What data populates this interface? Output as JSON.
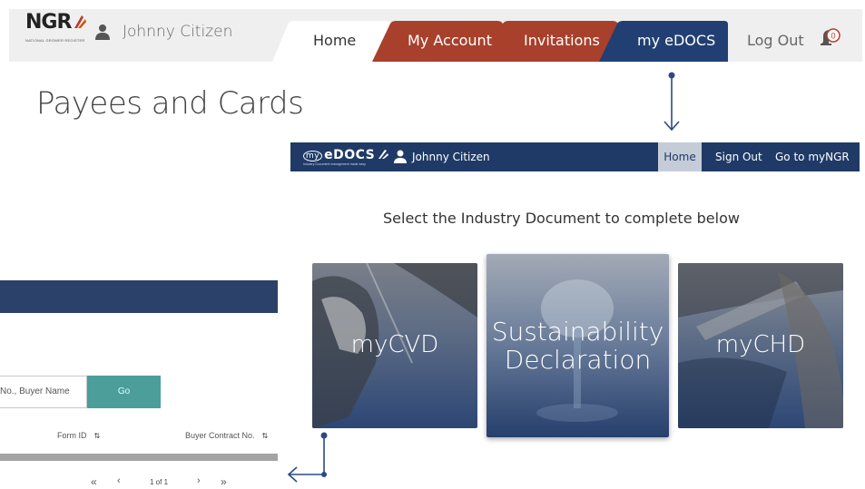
{
  "ngr_header": {
    "logo_text": "NGR",
    "logo_subtext": "NATIONAL GROWER REGISTER",
    "user_name": "Johnny Citizen",
    "tabs": [
      {
        "label": "Home"
      },
      {
        "label": "My Account"
      },
      {
        "label": "Invitations"
      },
      {
        "label": "my eDOCS"
      }
    ],
    "logout_label": "Log Out",
    "notification_count": "0",
    "colors": {
      "tab_rust": "#a8402b",
      "tab_navy": "#213f72",
      "bar_bg": "#efefef"
    }
  },
  "page_title": "Payees and Cards",
  "edocs_header": {
    "logo_my": "my",
    "logo_text": "eDOCS",
    "logo_subtext": "Industry Document management made easy",
    "user_name": "Johnny Citizen",
    "nav": {
      "home": "Home",
      "sign_out": "Sign Out",
      "go_to": "Go to myNGR"
    },
    "colors": {
      "bar_bg": "#1f3a66",
      "active_bg": "#c4ccd8"
    }
  },
  "select_prompt": "Select the Industry Document to complete below",
  "cards": {
    "cvd": "myCVD",
    "sust_line1": "Sustainability",
    "sust_line2": "Declaration",
    "chd": "myCHD"
  },
  "left_panel": {
    "search_placeholder": "No., Buyer Name",
    "go_label": "Go",
    "columns": {
      "form_id": "Form ID",
      "buyer_contract": "Buyer Contract No."
    },
    "sort_glyph": "⇅",
    "pagination": {
      "first": "«",
      "prev": "‹",
      "info": "1 of 1",
      "next": "›",
      "last": "»"
    }
  }
}
